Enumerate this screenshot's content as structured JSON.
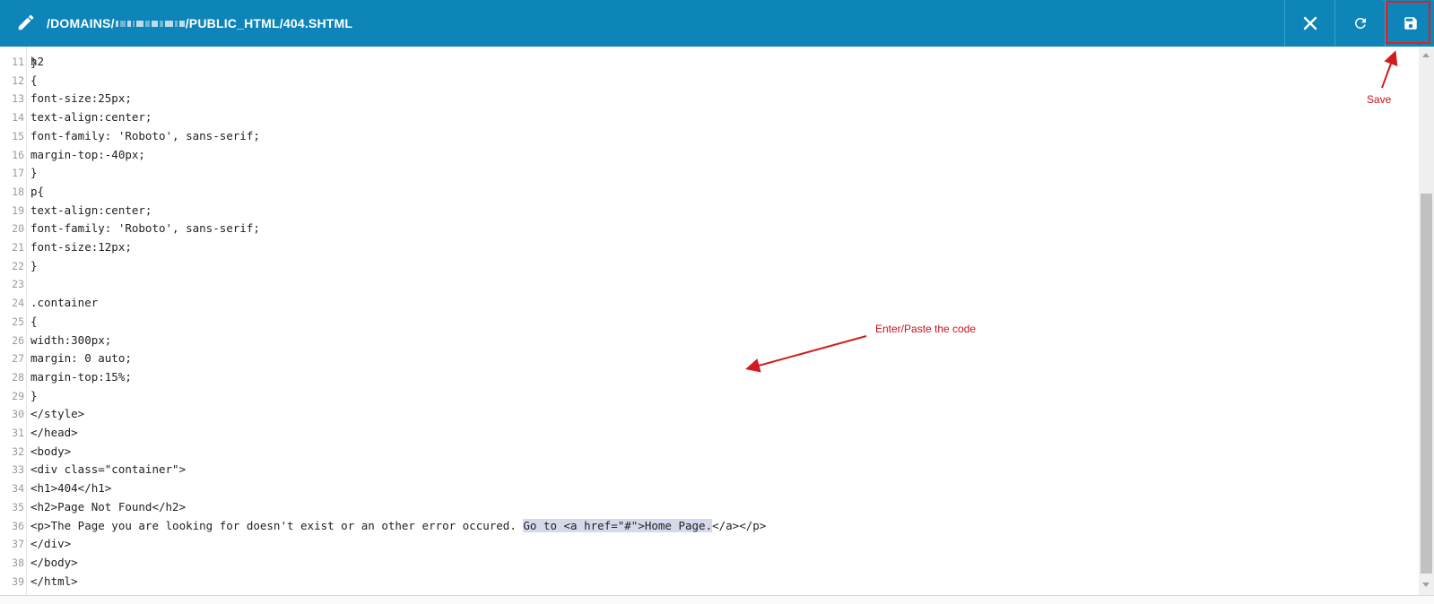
{
  "window": {
    "title_prefix": "/DOMAINS/",
    "title_suffix": "/PUBLIC_HTML/404.SHTML",
    "edit_icon": "pencil-icon",
    "close_icon": "close-icon",
    "reload_icon": "reload-icon",
    "save_icon": "floppy-save-icon",
    "accent_color": "#0d85b8"
  },
  "editor": {
    "lines": [
      {
        "num": "11",
        "text": "h2"
      },
      {
        "num": "12",
        "text": "{"
      },
      {
        "num": "13",
        "text": "font-size:25px;"
      },
      {
        "num": "14",
        "text": "text-align:center;"
      },
      {
        "num": "15",
        "text": "font-family: 'Roboto', sans-serif;"
      },
      {
        "num": "16",
        "text": "margin-top:-40px;"
      },
      {
        "num": "17",
        "text": "}"
      },
      {
        "num": "18",
        "text": "p{"
      },
      {
        "num": "19",
        "text": "text-align:center;"
      },
      {
        "num": "20",
        "text": "font-family: 'Roboto', sans-serif;"
      },
      {
        "num": "21",
        "text": "font-size:12px;"
      },
      {
        "num": "22",
        "text": "}"
      },
      {
        "num": "23",
        "text": ""
      },
      {
        "num": "24",
        "text": ".container"
      },
      {
        "num": "25",
        "text": "{"
      },
      {
        "num": "26",
        "text": "width:300px;"
      },
      {
        "num": "27",
        "text": "margin: 0 auto;"
      },
      {
        "num": "28",
        "text": "margin-top:15%;"
      },
      {
        "num": "29",
        "text": "}"
      },
      {
        "num": "30",
        "text": "</style>"
      },
      {
        "num": "31",
        "text": "</head>"
      },
      {
        "num": "32",
        "text": "<body>"
      },
      {
        "num": "33",
        "text": "<div class=\"container\">"
      },
      {
        "num": "34",
        "text": "<h1>404</h1>"
      },
      {
        "num": "35",
        "text": "<h2>Page Not Found</h2>"
      },
      {
        "num": "36",
        "text": "<p>The Page you are looking for doesn't exist or an other error occured. ",
        "selected": "Go to <a href=\"#\">Home Page.",
        "after": "</a></p>"
      },
      {
        "num": "37",
        "text": "</div>"
      },
      {
        "num": "38",
        "text": "</body>"
      },
      {
        "num": "39",
        "text": "</html>"
      }
    ]
  },
  "annotations": {
    "save_label": "Save",
    "paste_label": "Enter/Paste the code",
    "color": "#c8141e"
  }
}
